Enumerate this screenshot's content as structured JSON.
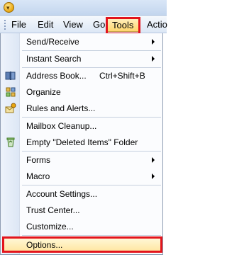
{
  "menubar": {
    "items": [
      {
        "label": "File"
      },
      {
        "label": "Edit"
      },
      {
        "label": "View"
      },
      {
        "label": "Go"
      },
      {
        "label": "Tools"
      },
      {
        "label": "Actio"
      }
    ]
  },
  "tools_menu": {
    "items": [
      {
        "label": "Send/Receive",
        "submenu": true
      },
      {
        "label": "Instant Search",
        "submenu": true
      },
      {
        "label": "Address Book...",
        "shortcut": "Ctrl+Shift+B",
        "icon": "address-book-icon"
      },
      {
        "label": "Organize",
        "icon": "organize-icon"
      },
      {
        "label": "Rules and Alerts...",
        "icon": "rules-alerts-icon"
      },
      {
        "label": "Mailbox Cleanup..."
      },
      {
        "label": "Empty \"Deleted Items\" Folder",
        "icon": "recycle-bin-icon"
      },
      {
        "label": "Forms",
        "submenu": true
      },
      {
        "label": "Macro",
        "submenu": true
      },
      {
        "label": "Account Settings..."
      },
      {
        "label": "Trust Center..."
      },
      {
        "label": "Customize..."
      },
      {
        "label": "Options..."
      }
    ]
  },
  "colors": {
    "highlight_box": "#e3141c",
    "hover_fill": "#ffe6a0"
  }
}
